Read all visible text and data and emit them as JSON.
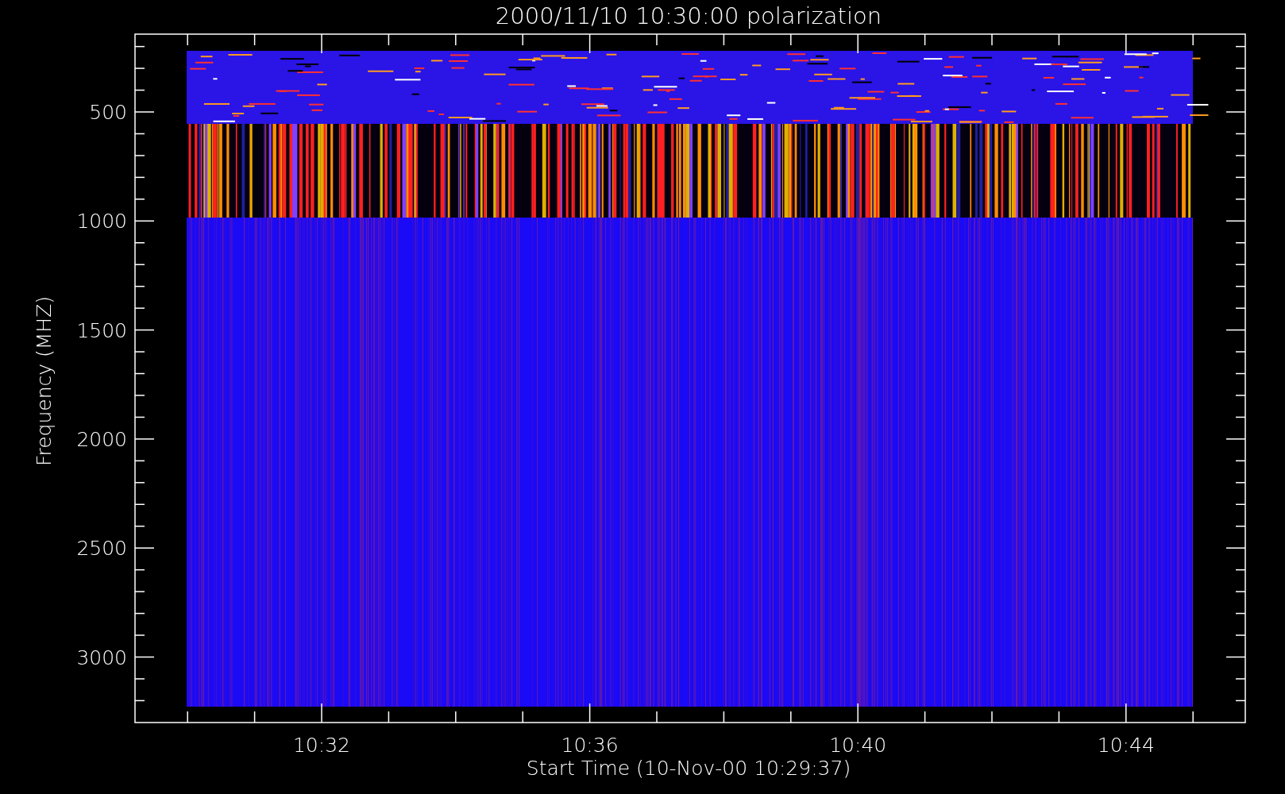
{
  "title": "2000/11/10 10:30:00 polarization",
  "y_axis": {
    "label": "Frequency (MHZ)",
    "ticks": [
      "500",
      "1000",
      "1500",
      "2000",
      "2500",
      "3000"
    ]
  },
  "x_axis": {
    "label": "Start Time (10-Nov-00 10:29:37)",
    "ticks": [
      "10:32",
      "10:36",
      "10:40",
      "10:44"
    ]
  }
}
